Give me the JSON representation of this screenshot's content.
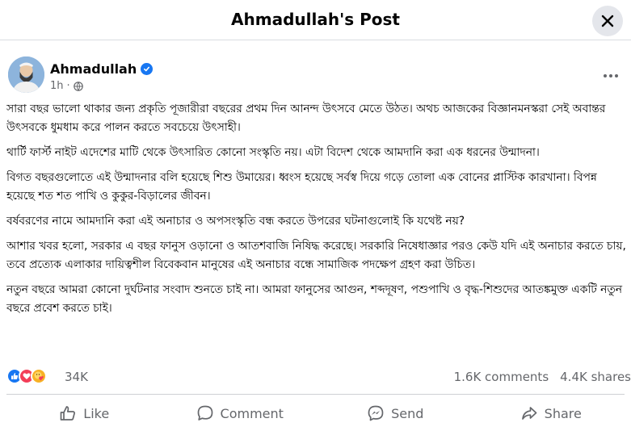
{
  "header": {
    "title": "Ahmadullah's Post"
  },
  "author": {
    "name": "Ahmadullah",
    "time": "1h",
    "avatar_icon": "profile-avatar",
    "verified_icon": "verified-badge-icon",
    "audience_icon": "globe-icon"
  },
  "post": {
    "paragraphs": [
      "সারা বছর ভালো থাকার জন্য প্রকৃতি পূজারীরা বছরের প্রথম দিন আনন্দ উৎসবে মেতে উঠত। অথচ আজকের বিজ্ঞানমনস্করা সেই অবান্তর উৎসবকে ধুমধাম করে পালন করতে সবচেয়ে উৎসাহী।",
      "থার্টি ফার্স্ট নাইট এদেশের মাটি থেকে উৎসারিত কোনো সংস্কৃতি নয়। এটা বিদেশ থেকে আমদানি করা এক ধরনের উন্মাদনা।",
      "বিগত বছরগুলোতে এই উন্মাদনার বলি হয়েছে শিশু উমায়ের। ধ্বংস হয়েছে সর্বস্ব দিয়ে গড়ে তোলা এক বোনের প্লাস্টিক কারখানা। বিপন্ন হয়েছে শত শত পাখি ও কুকুর-বিড়ালের জীবন।",
      "বর্ষবরণের নামে আমদানি করা এই অনাচার ও অপসংস্কৃতি বন্ধ করতে উপরের ঘটনাগুলোই কি যথেষ্ট নয়?",
      "আশার খবর হলো, সরকার এ বছর ফানুস ওড়ানো ও আতশবাজি নিষিদ্ধ করেছে। সরকারি নিষেধাজ্ঞার পরও কেউ যদি এই অনাচার করতে চায়, তবে প্রত্যেক এলাকার দায়িত্বশীল বিবেকবান মানুষের এই অনাচার বন্ধে সামাজিক পদক্ষেপ গ্রহণ করা উচিত।",
      "নতুন বছরে আমরা কোনো দুর্ঘটনার সংবাদ শুনতে চাই না। আমরা ফানুসের আগুন, শব্দদূষণ, পশুপাখি ও বৃদ্ধ-শিশুদের আতঙ্কমুক্ত একটি নতুন বছরে প্রবেশ করতে চাই।"
    ]
  },
  "reactions": {
    "count": "34K",
    "icons": [
      "like-reaction-icon",
      "love-reaction-icon",
      "care-reaction-icon"
    ]
  },
  "stats": {
    "comments": "1.6K comments",
    "shares": "4.4K shares"
  },
  "actions": {
    "like": "Like",
    "comment": "Comment",
    "send": "Send",
    "share": "Share"
  },
  "colors": {
    "accent": "#1877f2",
    "secondary_text": "#65676b",
    "love": "#f33e58",
    "care": "#f7b125"
  }
}
